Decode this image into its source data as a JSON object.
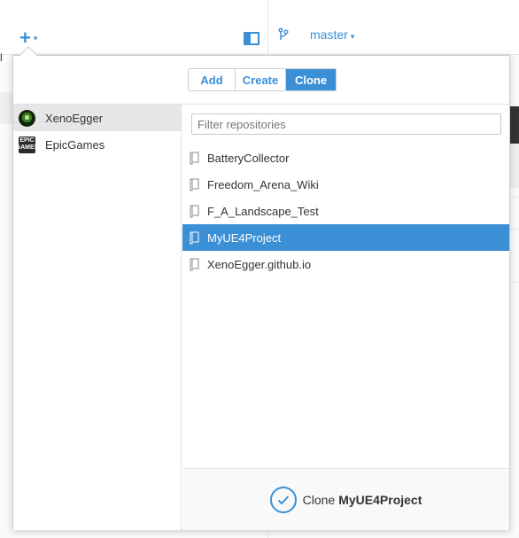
{
  "toolbar": {
    "add_icon": "plus-icon",
    "add_caret": "▾",
    "branch_name": "master",
    "branch_caret": "▾",
    "left_cut_text": "l"
  },
  "popover": {
    "tabs": [
      {
        "label": "Add",
        "active": false
      },
      {
        "label": "Create",
        "active": false
      },
      {
        "label": "Clone",
        "active": true
      }
    ],
    "owners": [
      {
        "name": "XenoEgger",
        "selected": true
      },
      {
        "name": "EpicGames",
        "selected": false,
        "avatar_text": "EPIC GAMES"
      }
    ],
    "filter": {
      "placeholder": "Filter repositories",
      "value": ""
    },
    "repos": [
      {
        "name": "BatteryCollector",
        "selected": false
      },
      {
        "name": "Freedom_Arena_Wiki",
        "selected": false
      },
      {
        "name": "F_A_Landscape_Test",
        "selected": false
      },
      {
        "name": "MyUE4Project",
        "selected": true
      },
      {
        "name": "XenoEgger.github.io",
        "selected": false
      }
    ],
    "footer": {
      "action_label": "Clone",
      "repo_name": "MyUE4Project"
    }
  },
  "colors": {
    "accent": "#3b8fd5",
    "selected_owner_bg": "#e6e6e6",
    "text": "#333333"
  }
}
